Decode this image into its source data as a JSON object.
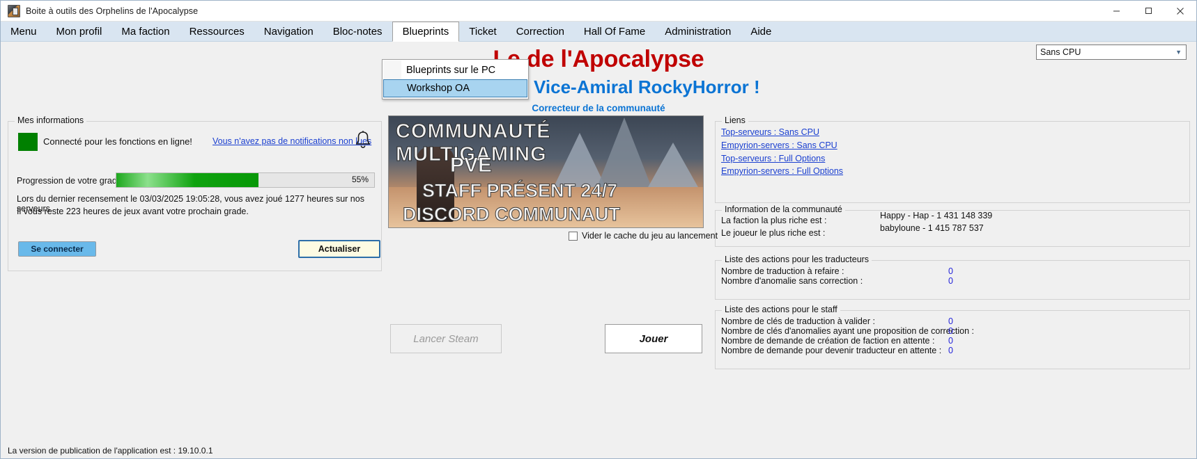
{
  "window": {
    "title": "Boite à outils des Orphelins de l'Apocalypse",
    "minimize": "–",
    "maximize": "☐",
    "close": "✕"
  },
  "menubar": {
    "items": [
      {
        "label": "Menu"
      },
      {
        "label": "Mon profil"
      },
      {
        "label": "Ma faction"
      },
      {
        "label": "Ressources"
      },
      {
        "label": "Navigation"
      },
      {
        "label": "Bloc-notes"
      },
      {
        "label": "Blueprints"
      },
      {
        "label": "Ticket"
      },
      {
        "label": "Correction"
      },
      {
        "label": "Hall Of Fame"
      },
      {
        "label": "Administration"
      },
      {
        "label": "Aide"
      }
    ],
    "open_index": 6
  },
  "dropdown": {
    "items": [
      {
        "label": "Blueprints sur le PC",
        "highlighted": false
      },
      {
        "label": "Workshop OA",
        "highlighted": true
      }
    ]
  },
  "header": {
    "main_title": "Le           de l'Apocalypse",
    "welcome": "Bienvenue Vice-Amiral RockyHorror !",
    "corrector": "Correcteur de la communauté",
    "cpu_select": {
      "value": "Sans CPU",
      "arrow": "▼"
    }
  },
  "my_info": {
    "legend": "Mes informations",
    "status_text": "Connecté pour les fonctions en ligne!",
    "notifications_link": "Vous n'avez pas de notifications non lues",
    "bell_icon": "bell-icon",
    "grade_label": "Progression de votre grade :",
    "progress_percent": 55,
    "progress_percent_label": "55%",
    "info_line_1": "Lors du dernier recensement le 03/03/2025 19:05:28, vous avez joué 1277 heures sur nos serveurs.",
    "info_line_2": "Il vous reste 223 heures de jeux avant votre prochain grade.",
    "connect_button": "Se connecter",
    "refresh_button": "Actualiser"
  },
  "center": {
    "banner": {
      "line1": "COMMUNAUTÉ MULTIGAMING",
      "line2": "PVE",
      "line3": "STAFF PRÉSENT 24/7",
      "line4": "DISCORD COMMUNAUT"
    },
    "cache_checkbox_label": "Vider le cache du jeu au lancement",
    "cache_checked": false,
    "steam_button": "Lancer Steam",
    "play_button": "Jouer"
  },
  "links": {
    "legend": "Liens",
    "items": [
      {
        "label": "Top-serveurs : Sans CPU"
      },
      {
        "label": "Empyrion-servers : Sans CPU"
      },
      {
        "label": "Top-serveurs : Full Options"
      },
      {
        "label": "Empyrion-servers : Full Options"
      }
    ]
  },
  "community_info": {
    "legend": "Information de la communauté",
    "rows": [
      {
        "label": "La faction la plus riche est :",
        "value": "Happy - Hap - 1 431 148 339"
      },
      {
        "label": "Le joueur le plus riche est :",
        "value": "babyloune - 1 415 787 537"
      }
    ]
  },
  "translator_actions": {
    "legend": "Liste des actions pour les traducteurs",
    "rows": [
      {
        "label": "Nombre de traduction à refaire :",
        "value": "0"
      },
      {
        "label": "Nombre d'anomalie sans correction :",
        "value": "0"
      }
    ]
  },
  "staff_actions": {
    "legend": "Liste des actions pour le staff",
    "rows": [
      {
        "label": "Nombre de clés de traduction à valider :",
        "value": "0"
      },
      {
        "label": "Nombre de clés d'anomalies ayant une proposition de correction :",
        "value": "0"
      },
      {
        "label": "Nombre de demande de création de faction en attente :",
        "value": "0"
      },
      {
        "label": "Nombre de demande pour devenir traducteur en attente :",
        "value": "0"
      }
    ]
  },
  "statusbar": {
    "text": "La version de publication de l'application est : 19.10.0.1"
  },
  "colors": {
    "accent_red": "#c00000",
    "accent_blue": "#0b74d4",
    "link": "#1a3fd0",
    "menu_bg": "#d9e5f1",
    "status_green": "#008000",
    "value_blue": "#2323d8"
  }
}
